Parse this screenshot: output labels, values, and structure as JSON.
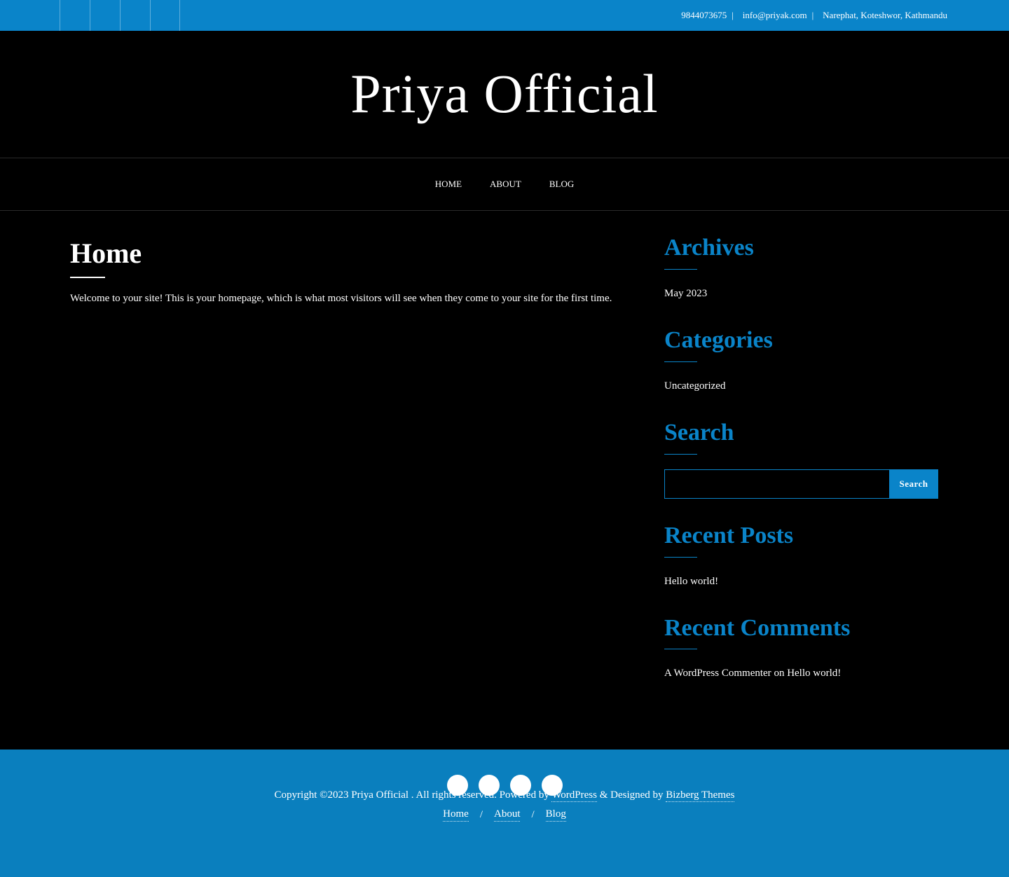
{
  "topbar": {
    "social_icons": [
      "facebook-icon",
      "twitter-icon",
      "instagram-icon",
      "linkedin-icon"
    ],
    "icon_glyph": "",
    "phone_icon": "",
    "phone": "9844073675",
    "email_icon": "",
    "email": "info@priyak.com",
    "address_icon": "",
    "address": "Narephat, Koteshwor, Kathmandu",
    "separator": "|"
  },
  "header": {
    "site_title": "Priya Official"
  },
  "nav": {
    "items": [
      "Home",
      "About",
      "Blog"
    ]
  },
  "main": {
    "title": "Home",
    "intro": "Welcome to your site! This is your homepage, which is what most visitors will see when they come to your site for the first time."
  },
  "sidebar": {
    "archives": {
      "title": "Archives",
      "items": [
        "May 2023"
      ]
    },
    "categories": {
      "title": "Categories",
      "items": [
        "Uncategorized"
      ]
    },
    "search": {
      "title": "Search",
      "placeholder": "",
      "button": "Search"
    },
    "recent_posts": {
      "title": "Recent Posts",
      "items": [
        "Hello world!"
      ]
    },
    "recent_comments": {
      "title": "Recent Comments",
      "author": "A WordPress Commenter",
      "on": "on",
      "post": "Hello world!"
    }
  },
  "footer": {
    "social_icons": [
      "facebook-icon",
      "twitter-icon",
      "instagram-icon",
      "linkedin-icon"
    ],
    "icon_glyph": "",
    "nav": [
      "Home",
      "About",
      "Blog"
    ],
    "separator": "/",
    "copyright_prefix": "Copyright ©2023 Priya Official . All rights reserved. Powered by",
    "wordpress": "WordPress",
    "designed_by": "& Designed by",
    "designer": "Bizberg Themes"
  },
  "colors": {
    "accent": "#0a84c9",
    "footer_bg": "#0a7fbe",
    "background": "#000000"
  }
}
